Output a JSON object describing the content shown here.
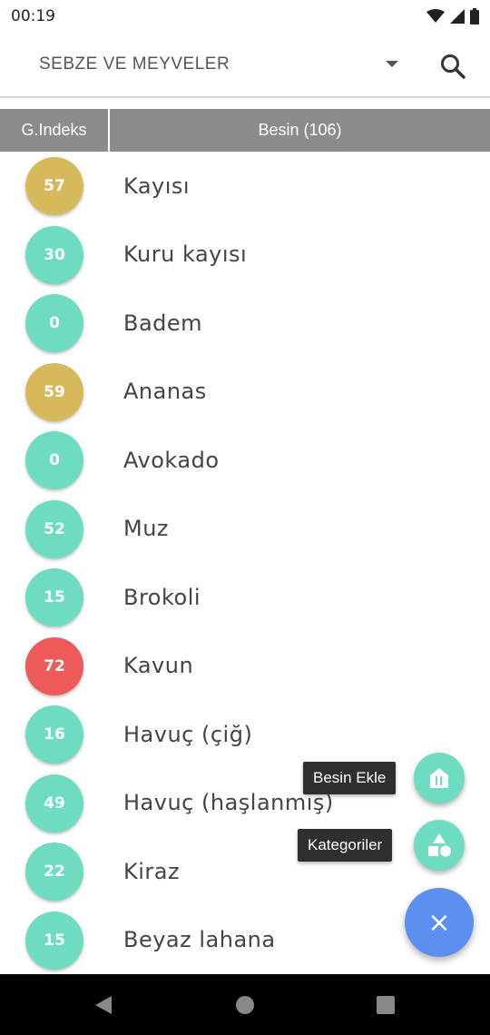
{
  "status": {
    "time": "00:19"
  },
  "appbar": {
    "title": "SEBZE VE MEYVELER"
  },
  "table": {
    "header_gi": "G.Indeks",
    "header_name": "Besin (106)"
  },
  "colors": {
    "low": "#6ddcc0",
    "medium": "#d6b95a",
    "high": "#ec5a5a",
    "main_fab": "#5b8ff0"
  },
  "items": [
    {
      "gi": "57",
      "name": "Kayısı",
      "level": "medium"
    },
    {
      "gi": "30",
      "name": "Kuru kayısı",
      "level": "low"
    },
    {
      "gi": "0",
      "name": "Badem",
      "level": "low"
    },
    {
      "gi": "59",
      "name": "Ananas",
      "level": "medium"
    },
    {
      "gi": "0",
      "name": "Avokado",
      "level": "low"
    },
    {
      "gi": "52",
      "name": "Muz",
      "level": "low"
    },
    {
      "gi": "15",
      "name": "Brokoli",
      "level": "low"
    },
    {
      "gi": "72",
      "name": "Kavun",
      "level": "high"
    },
    {
      "gi": "16",
      "name": "Havuç (çiğ)",
      "level": "low"
    },
    {
      "gi": "49",
      "name": "Havuç (haşlanmış)",
      "level": "low"
    },
    {
      "gi": "22",
      "name": "Kiraz",
      "level": "low"
    },
    {
      "gi": "15",
      "name": "Beyaz lahana",
      "level": "low"
    }
  ],
  "fab": {
    "add_food_label": "Besin Ekle",
    "categories_label": "Kategoriler",
    "close_symbol": "×"
  }
}
